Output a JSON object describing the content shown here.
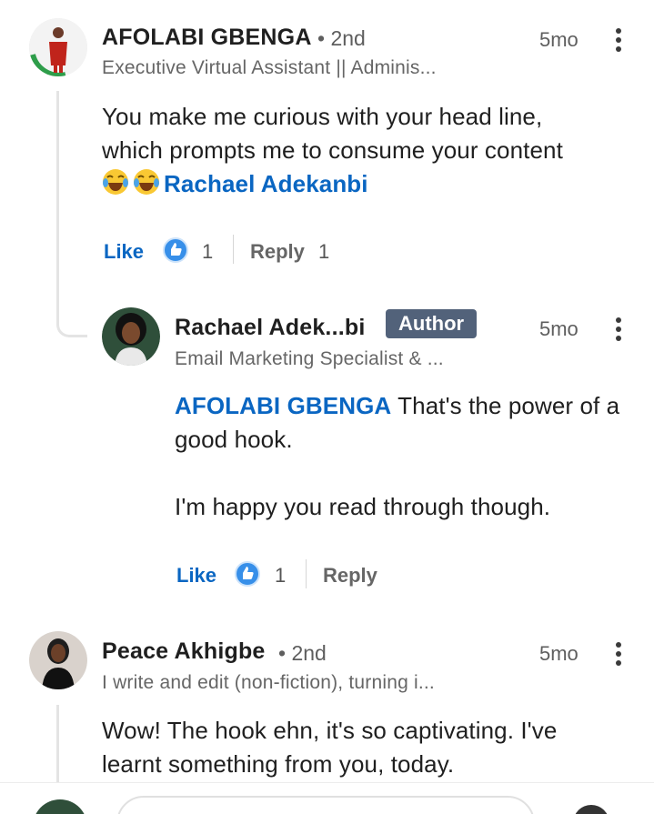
{
  "comments": [
    {
      "author": "AFOLABI GBENGA",
      "degree": "• 2nd",
      "headline": "Executive Virtual Assistant || Adminis...",
      "time": "5mo",
      "body_line1": "You make me curious with your head line,",
      "body_line2": "which prompts me to consume your content",
      "mention": "Rachael Adekanbi",
      "like_label": "Like",
      "like_count": "1",
      "reply_label": "Reply",
      "reply_count": "1"
    },
    {
      "author": "Rachael Adek...bi",
      "badge": "Author",
      "headline": "Email Marketing Specialist & ...",
      "time": "5mo",
      "mention": "AFOLABI GBENGA",
      "body_after_mention": " That's the power of a",
      "body_line2": "good hook.",
      "body_line3": "I'm happy you read through though.",
      "like_label": "Like",
      "like_count": "1",
      "reply_label": "Reply"
    },
    {
      "author": "Peace Akhigbe",
      "degree": "• 2nd",
      "headline": "I write and edit (non-fiction), turning i...",
      "time": "5mo",
      "body_line1": "Wow! The hook ehn, it's so captivating. I've",
      "body_line2": "learnt something from you, today."
    }
  ],
  "colors": {
    "mention": "#0a66c2",
    "like_icon": "#378fe9",
    "author_badge": "#52627a"
  }
}
